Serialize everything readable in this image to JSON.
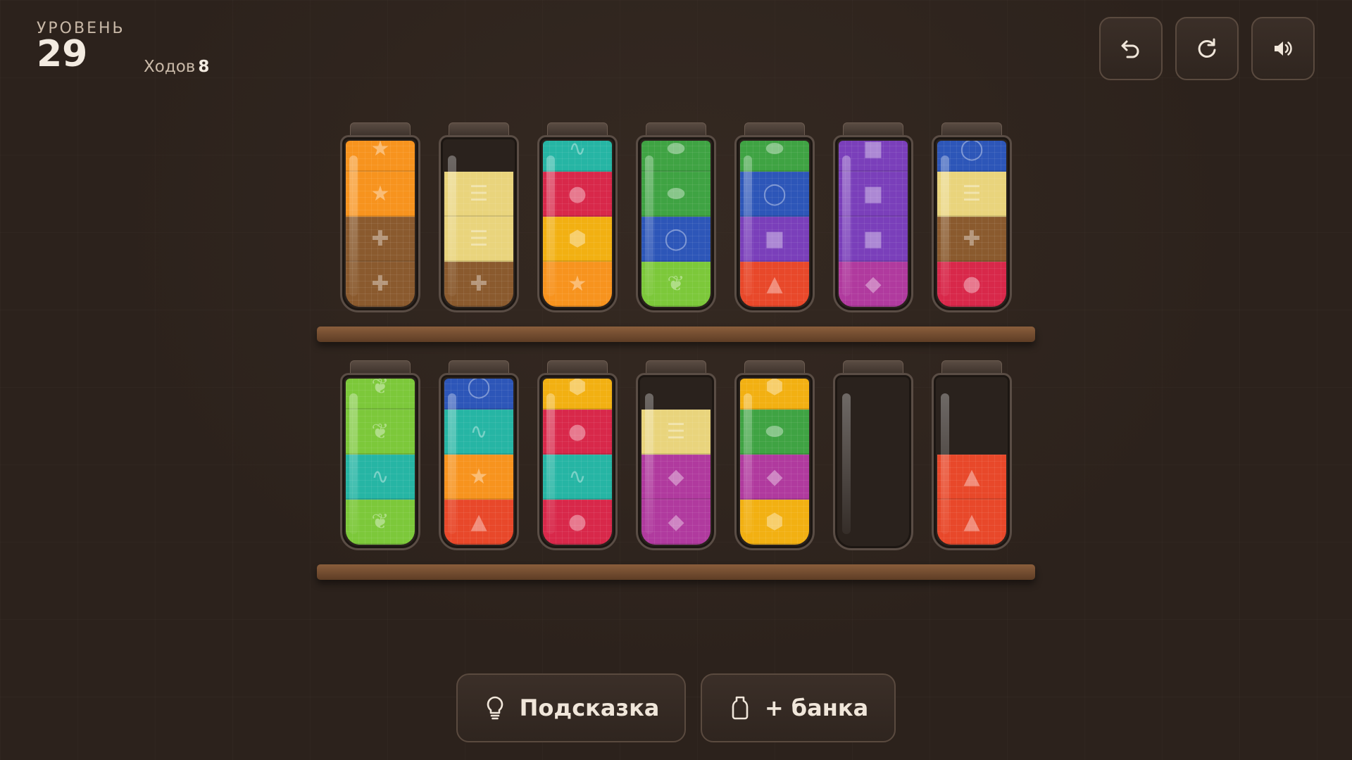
{
  "header": {
    "level_label": "УРОВЕНЬ",
    "level_number": "29",
    "moves_label": "Ходов",
    "moves_count": "8"
  },
  "controls": {
    "undo_icon": "undo-icon",
    "restart_icon": "restart-icon",
    "sound_icon": "sound-icon"
  },
  "colors": {
    "orange": "#f7931e",
    "brown": "#8a5a2e",
    "cream": "#e9d47c",
    "teal": "#26b5a4",
    "red": "#d8284a",
    "amber": "#f2b012",
    "green": "#3fa343",
    "blue": "#2d56b8",
    "purple": "#7a3fba",
    "redorange": "#e8482a",
    "magenta": "#b03a9e",
    "lime": "#7cc83a"
  },
  "glyphs": {
    "orange": "★",
    "brown": "✚",
    "cream": "☰",
    "teal": "∿",
    "red": "●",
    "amber": "⬢",
    "green": "⬬",
    "blue": "◯",
    "purple": "■",
    "redorange": "▲",
    "magenta": "◆",
    "lime": "❦"
  },
  "shelves": [
    {
      "jars": [
        {
          "layers": [
            "orange",
            "orange",
            "brown",
            "brown"
          ]
        },
        {
          "layers": [
            "cream",
            "cream",
            "brown"
          ]
        },
        {
          "layers": [
            "teal",
            "red",
            "amber",
            "orange"
          ]
        },
        {
          "layers": [
            "green",
            "green",
            "blue",
            "lime"
          ]
        },
        {
          "layers": [
            "green",
            "blue",
            "purple",
            "redorange"
          ]
        },
        {
          "layers": [
            "purple",
            "purple",
            "purple",
            "magenta"
          ]
        },
        {
          "layers": [
            "blue",
            "cream",
            "brown",
            "red"
          ]
        }
      ]
    },
    {
      "jars": [
        {
          "layers": [
            "lime",
            "lime",
            "teal",
            "lime"
          ]
        },
        {
          "layers": [
            "blue",
            "teal",
            "orange",
            "redorange"
          ]
        },
        {
          "layers": [
            "amber",
            "red",
            "teal",
            "red"
          ]
        },
        {
          "layers": [
            "cream",
            "magenta",
            "magenta"
          ]
        },
        {
          "layers": [
            "amber",
            "green",
            "magenta",
            "amber"
          ]
        },
        {
          "layers": []
        },
        {
          "layers": [
            "redorange",
            "redorange"
          ]
        }
      ]
    }
  ],
  "actions": {
    "hint_label": "Подсказка",
    "hint_icon": "lightbulb-icon",
    "add_jar_label": "+ банка",
    "add_jar_icon": "jar-icon"
  }
}
